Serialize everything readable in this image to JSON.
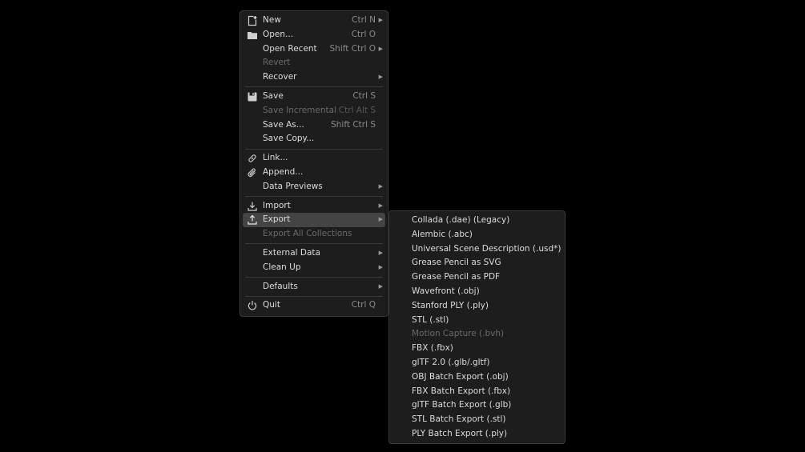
{
  "file_menu": {
    "groups": [
      [
        {
          "label": "New",
          "shortcut": "Ctrl N",
          "submenu": true,
          "icon": "new-file-icon"
        },
        {
          "label": "Open...",
          "shortcut": "Ctrl O",
          "icon": "folder-icon"
        },
        {
          "label": "Open Recent",
          "shortcut": "Shift Ctrl O",
          "submenu": true
        },
        {
          "label": "Revert",
          "disabled": true
        },
        {
          "label": "Recover",
          "submenu": true
        }
      ],
      [
        {
          "label": "Save",
          "shortcut": "Ctrl S",
          "icon": "save-icon"
        },
        {
          "label": "Save Incremental",
          "shortcut": "Ctrl Alt S",
          "disabled": true
        },
        {
          "label": "Save As...",
          "shortcut": "Shift Ctrl S"
        },
        {
          "label": "Save Copy..."
        }
      ],
      [
        {
          "label": "Link...",
          "icon": "link-icon"
        },
        {
          "label": "Append...",
          "icon": "paperclip-icon"
        },
        {
          "label": "Data Previews",
          "submenu": true
        }
      ],
      [
        {
          "label": "Import",
          "submenu": true,
          "icon": "import-icon"
        },
        {
          "label": "Export",
          "submenu": true,
          "icon": "export-icon",
          "highlighted": true
        },
        {
          "label": "Export All Collections",
          "disabled": true
        }
      ],
      [
        {
          "label": "External Data",
          "submenu": true
        },
        {
          "label": "Clean Up",
          "submenu": true
        }
      ],
      [
        {
          "label": "Defaults",
          "submenu": true
        }
      ],
      [
        {
          "label": "Quit",
          "shortcut": "Ctrl Q",
          "icon": "power-icon"
        }
      ]
    ]
  },
  "export_menu": {
    "items": [
      {
        "label": "Collada (.dae) (Legacy)"
      },
      {
        "label": "Alembic (.abc)"
      },
      {
        "label": "Universal Scene Description (.usd*)"
      },
      {
        "label": "Grease Pencil as SVG"
      },
      {
        "label": "Grease Pencil as PDF"
      },
      {
        "label": "Wavefront (.obj)"
      },
      {
        "label": "Stanford PLY (.ply)"
      },
      {
        "label": "STL (.stl)"
      },
      {
        "label": "Motion Capture (.bvh)",
        "disabled": true
      },
      {
        "label": "FBX (.fbx)"
      },
      {
        "label": "glTF 2.0 (.glb/.gltf)"
      },
      {
        "label": "OBJ Batch Export (.obj)"
      },
      {
        "label": "FBX Batch Export (.fbx)"
      },
      {
        "label": "glTF Batch Export (.glb)"
      },
      {
        "label": "STL Batch Export (.stl)"
      },
      {
        "label": "PLY Batch Export (.ply)"
      }
    ]
  },
  "colors": {
    "background": "#000000",
    "menu_bg": "#1d1d1d",
    "highlight": "#444444",
    "text": "#dcdcdc",
    "disabled_text": "#6a6a6a"
  }
}
